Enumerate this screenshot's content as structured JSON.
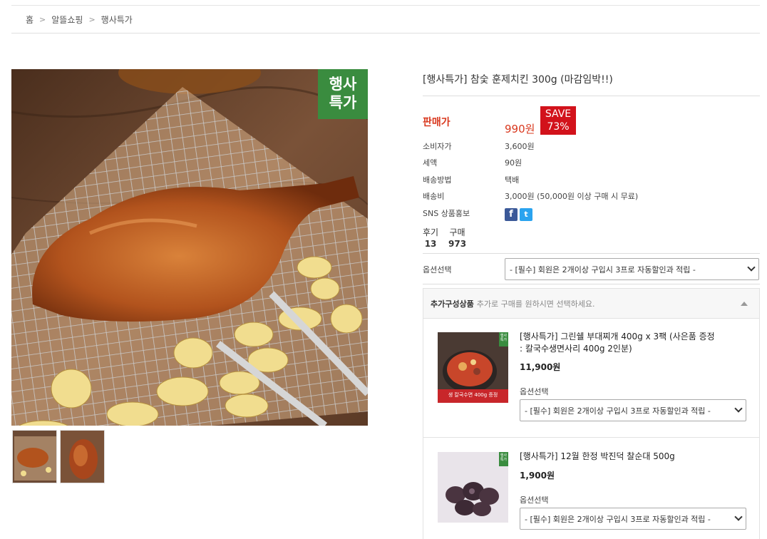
{
  "breadcrumb": {
    "home": "홈",
    "shop": "알뜰쇼핑",
    "current": "행사특가"
  },
  "product": {
    "badge_line1": "행사",
    "badge_line2": "특가",
    "title": "[행사특가] 참숯 훈제치킨 300g (마감임박!!)",
    "price_label": "판매가",
    "price": "990원",
    "save_line1": "SAVE",
    "save_line2": "73%",
    "consumer_price_label": "소비자가",
    "consumer_price": "3,600원",
    "tax_label": "세액",
    "tax": "90원",
    "shipping_method_label": "배송방법",
    "shipping_method": "택배",
    "shipping_fee_label": "배송비",
    "shipping_fee": "3,000원 (50,000원 이상 구매 시 무료)",
    "sns_label": "SNS 상품홍보",
    "review_label": "후기",
    "review_count": "13",
    "purchase_label": "구매",
    "purchase_count": "973",
    "option_label": "옵션선택",
    "option_value": "- [필수] 회원은 2개이상 구입시 3프로 자동할인과 적립 -"
  },
  "addons": {
    "header": "추가구성상품",
    "header_sub": "추가로 구매를 원하시면 선택하세요.",
    "items": [
      {
        "title_line1": "[행사특가] 그린쉘 부대찌개 400g x 3팩 (사은품 증정",
        "title_line2": ": 칼국수생면사리 400g 2인분)",
        "price": "11,900원",
        "option_label": "옵션선택",
        "option_value": "- [필수] 회원은 2개이상 구입시 3프로 자동할인과 적립 -",
        "img_banner": "생 칼국수면 400g 증정"
      },
      {
        "title_line1": "[행사특가] 12월 한정 박진덕 찰순대 500g",
        "price": "1,900원",
        "option_label": "옵션선택",
        "option_value": "- [필수] 회원은 2개이상 구입시 3프로 자동할인과 적립 -"
      }
    ]
  },
  "colors": {
    "accent_red": "#d9381e",
    "save_red": "#d2121b",
    "badge_green": "#3a8c3f",
    "facebook": "#3b5998",
    "twitter": "#2aa3ef"
  },
  "icons": {
    "facebook": "facebook-icon",
    "twitter": "twitter-icon",
    "breadcrumb_sep": "chevron-right-icon",
    "dropdown": "chevron-down-icon",
    "collapse": "caret-up-icon"
  }
}
